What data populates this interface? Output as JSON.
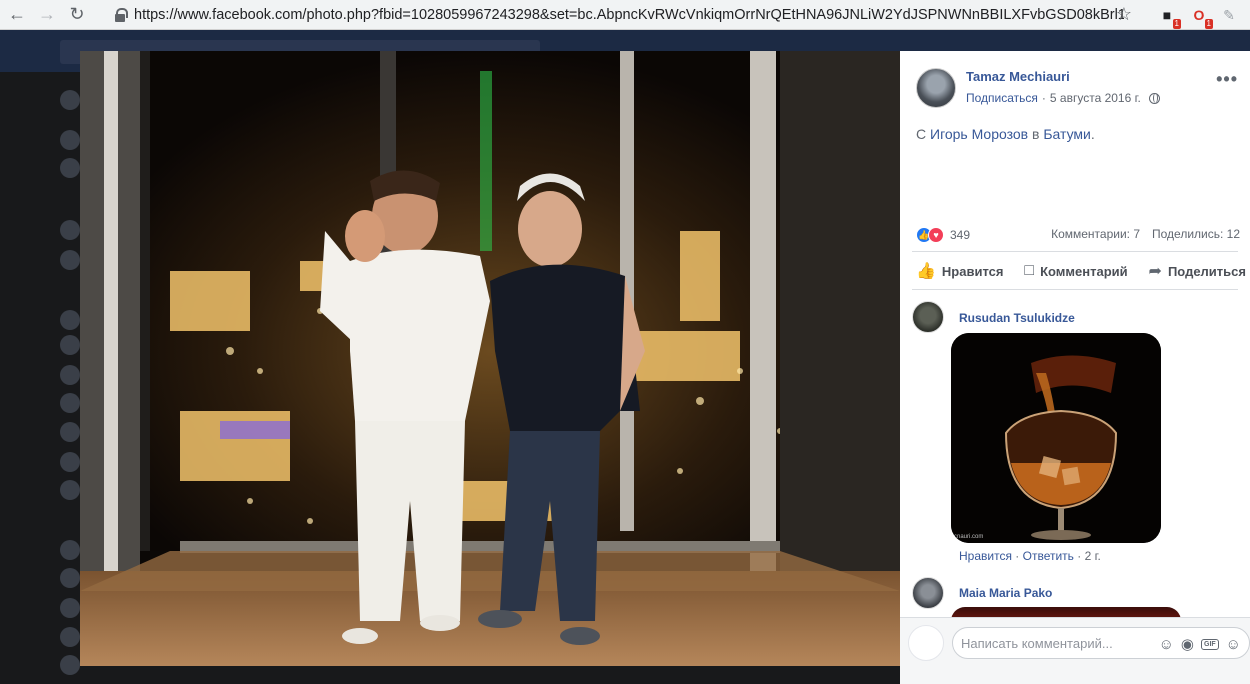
{
  "browser": {
    "url": "https://www.facebook.com/photo.php?fbid=1028059967243298&set=bc.AbpncKvRWcVnkiqmOrrNrQEtHNA96JNLiW2YdJSPNWNnBBILXFvbGSD08kBrl1nz...",
    "back_icon": "back-arrow-icon",
    "forward_icon": "forward-arrow-icon",
    "reload_icon": "reload-icon",
    "extensions": [
      {
        "icon": "extension-icon",
        "badge": "1"
      },
      {
        "icon": "opera-icon",
        "badge": "1"
      },
      {
        "icon": "translate-icon",
        "badge": ""
      }
    ]
  },
  "post": {
    "author": "Tamaz Mechiauri",
    "follow_label": "Подписаться",
    "separator": "·",
    "date": "5 августа 2016 г.",
    "text_prefix": "С ",
    "tagged_person": "Игорь Морозов",
    "text_middle": " в ",
    "location": "Батуми",
    "text_suffix": ".",
    "reaction_count": "349",
    "comments_count": "Комментарии: 7",
    "shares_count": "Поделились: 12"
  },
  "actions": {
    "like": "Нравится",
    "comment": "Комментарий",
    "share": "Поделиться"
  },
  "comments": [
    {
      "author": "Rusudan Tsulukidze",
      "image_watermark": "cnauri.com",
      "like_label": "Нравится",
      "reply_label": "Ответить",
      "time": "2 г."
    },
    {
      "author": "Maia Maria Pako"
    }
  ],
  "composer": {
    "placeholder": "Написать комментарий..."
  },
  "colors": {
    "link": "#385898",
    "muted": "#616770",
    "like_blue": "#2078f4",
    "love_red": "#f33e58"
  }
}
